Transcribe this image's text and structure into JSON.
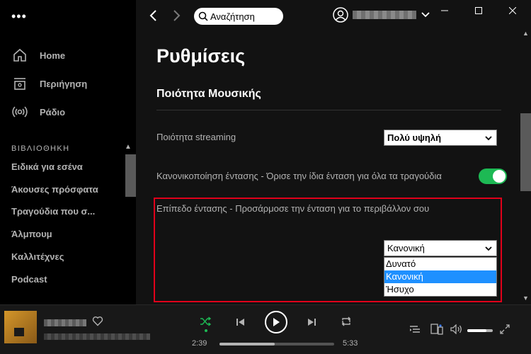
{
  "sidebar": {
    "menu_glyph": "•••",
    "nav": [
      {
        "label": "Home",
        "icon": "home-icon"
      },
      {
        "label": "Περιήγηση",
        "icon": "browse-icon"
      },
      {
        "label": "Ράδιο",
        "icon": "radio-icon"
      }
    ],
    "library_title": "ΒΙΒΛΙΟΘΗΚΗ",
    "library_items": [
      "Ειδικά για εσένα",
      "Άκουσες πρόσφατα",
      "Τραγούδια που σ...",
      "Άλμπουμ",
      "Καλλιτέχνες",
      "Podcast"
    ]
  },
  "topbar": {
    "search_placeholder": "Αναζήτηση"
  },
  "settings": {
    "title": "Ρυθμίσεις",
    "section": "Ποιότητα Μουσικής",
    "streaming_label": "Ποιότητα streaming",
    "streaming_value": "Πολύ υψηλή",
    "normalize_label": "Κανονικοποίηση έντασης - Όρισε την ίδια ένταση για όλα τα τραγούδια",
    "normalize_on": true,
    "volume_level_label": "Επίπεδο έντασης - Προσάρμοσε την ένταση για το περιβάλλον σου",
    "volume_level_value": "Κανονική",
    "volume_level_options": [
      "Δυνατό",
      "Κανονική",
      "Ήσυχο"
    ],
    "volume_level_selected_index": 1
  },
  "player": {
    "elapsed": "2:39",
    "duration": "5:33",
    "progress_fraction": 0.48,
    "volume_fraction": 0.75
  },
  "colors": {
    "accent": "#1db954",
    "highlight_box": "#e1001a",
    "selected_option": "#1e90ff"
  }
}
